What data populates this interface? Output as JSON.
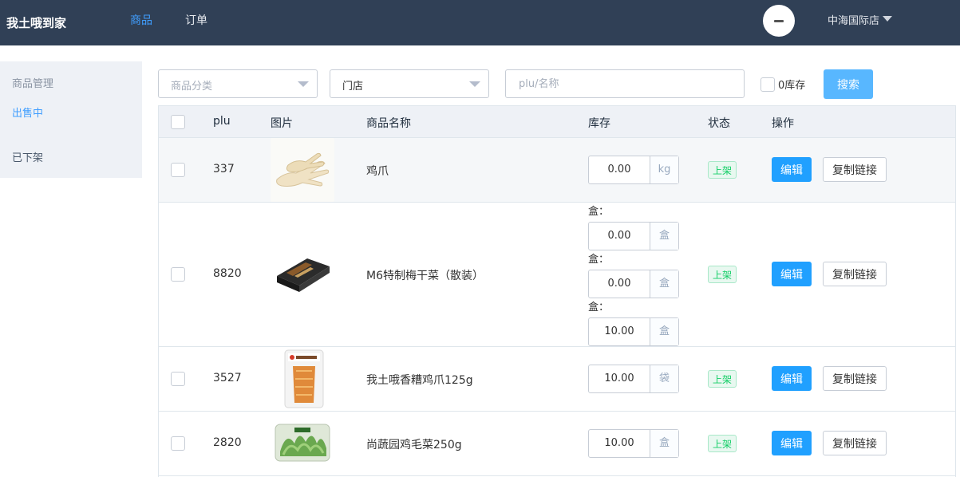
{
  "header": {
    "brand": "我土哦到家",
    "nav": [
      {
        "label": "商品",
        "active": true
      },
      {
        "label": "订单",
        "active": false
      }
    ],
    "store_name": "中海国际店"
  },
  "sidebar": {
    "title": "商品管理",
    "items": [
      {
        "label": "出售中",
        "active": true
      },
      {
        "label": "已下架",
        "active": false
      }
    ]
  },
  "filters": {
    "category_placeholder": "商品分类",
    "store_placeholder": "门店",
    "search_placeholder": "plu/名称",
    "zero_stock_label": "0库存",
    "zero_stock_checked": false,
    "search_button": "搜索"
  },
  "table": {
    "columns": [
      "plu",
      "图片",
      "商品名称",
      "库存",
      "状态",
      "操作"
    ],
    "rows": [
      {
        "plu": "337",
        "name": "鸡爪",
        "image": "chicken-feet-photo",
        "stocks": [
          {
            "label": "",
            "value": "0.00",
            "unit": "kg"
          }
        ],
        "status": "上架",
        "edit": "编辑",
        "copy": "复制链接"
      },
      {
        "plu": "8820",
        "name": "M6特制梅干菜（散装）",
        "image": "preserved-vegetable-box-photo",
        "stocks": [
          {
            "label": "盒：",
            "value": "0.00",
            "unit": "盒"
          },
          {
            "label": "盒：",
            "value": "0.00",
            "unit": "盒"
          },
          {
            "label": "盒：",
            "value": "10.00",
            "unit": "盒"
          }
        ],
        "status": "上架",
        "edit": "编辑",
        "copy": "复制链接"
      },
      {
        "plu": "3527",
        "name": "我土哦香糟鸡爪125g",
        "image": "packaged-chicken-feet-photo",
        "stocks": [
          {
            "label": "",
            "value": "10.00",
            "unit": "袋"
          }
        ],
        "status": "上架",
        "edit": "编辑",
        "copy": "复制链接"
      },
      {
        "plu": "2820",
        "name": "尚蔬园鸡毛菜250g",
        "image": "leafy-greens-box-photo",
        "stocks": [
          {
            "label": "",
            "value": "10.00",
            "unit": "盒"
          }
        ],
        "status": "上架",
        "edit": "编辑",
        "copy": "复制链接"
      }
    ]
  }
}
